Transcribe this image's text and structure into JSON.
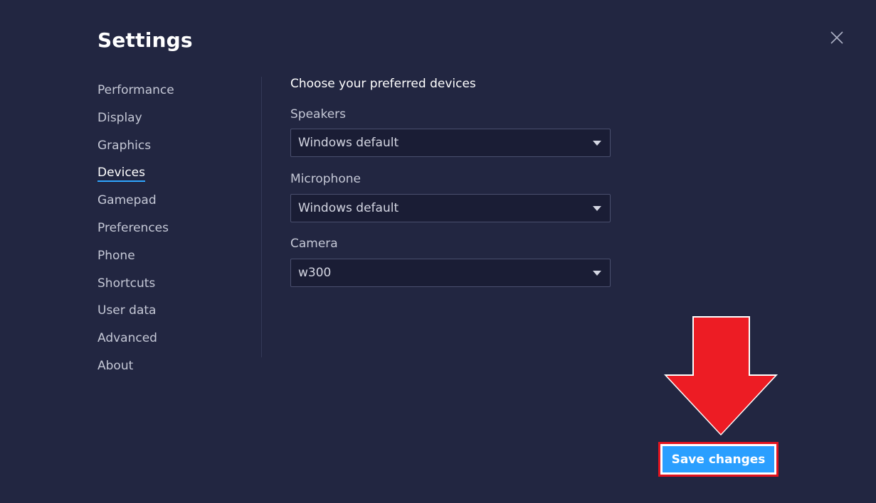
{
  "window": {
    "title": "Settings",
    "close_icon": "close-icon"
  },
  "sidebar": {
    "items": [
      {
        "label": "Performance",
        "active": false
      },
      {
        "label": "Display",
        "active": false
      },
      {
        "label": "Graphics",
        "active": false
      },
      {
        "label": "Devices",
        "active": true
      },
      {
        "label": "Gamepad",
        "active": false
      },
      {
        "label": "Preferences",
        "active": false
      },
      {
        "label": "Phone",
        "active": false
      },
      {
        "label": "Shortcuts",
        "active": false
      },
      {
        "label": "User data",
        "active": false
      },
      {
        "label": "Advanced",
        "active": false
      },
      {
        "label": "About",
        "active": false
      }
    ]
  },
  "devices": {
    "section_title": "Choose your preferred devices",
    "speakers": {
      "label": "Speakers",
      "value": "Windows default"
    },
    "microphone": {
      "label": "Microphone",
      "value": "Windows default"
    },
    "camera": {
      "label": "Camera",
      "value": "w300"
    }
  },
  "footer": {
    "save_label": "Save changes"
  },
  "annotation": {
    "icon": "down-arrow-icon",
    "color": "#ed1c24"
  },
  "colors": {
    "background": "#222641",
    "accent": "#2a9fff",
    "highlight": "#e3141f"
  }
}
